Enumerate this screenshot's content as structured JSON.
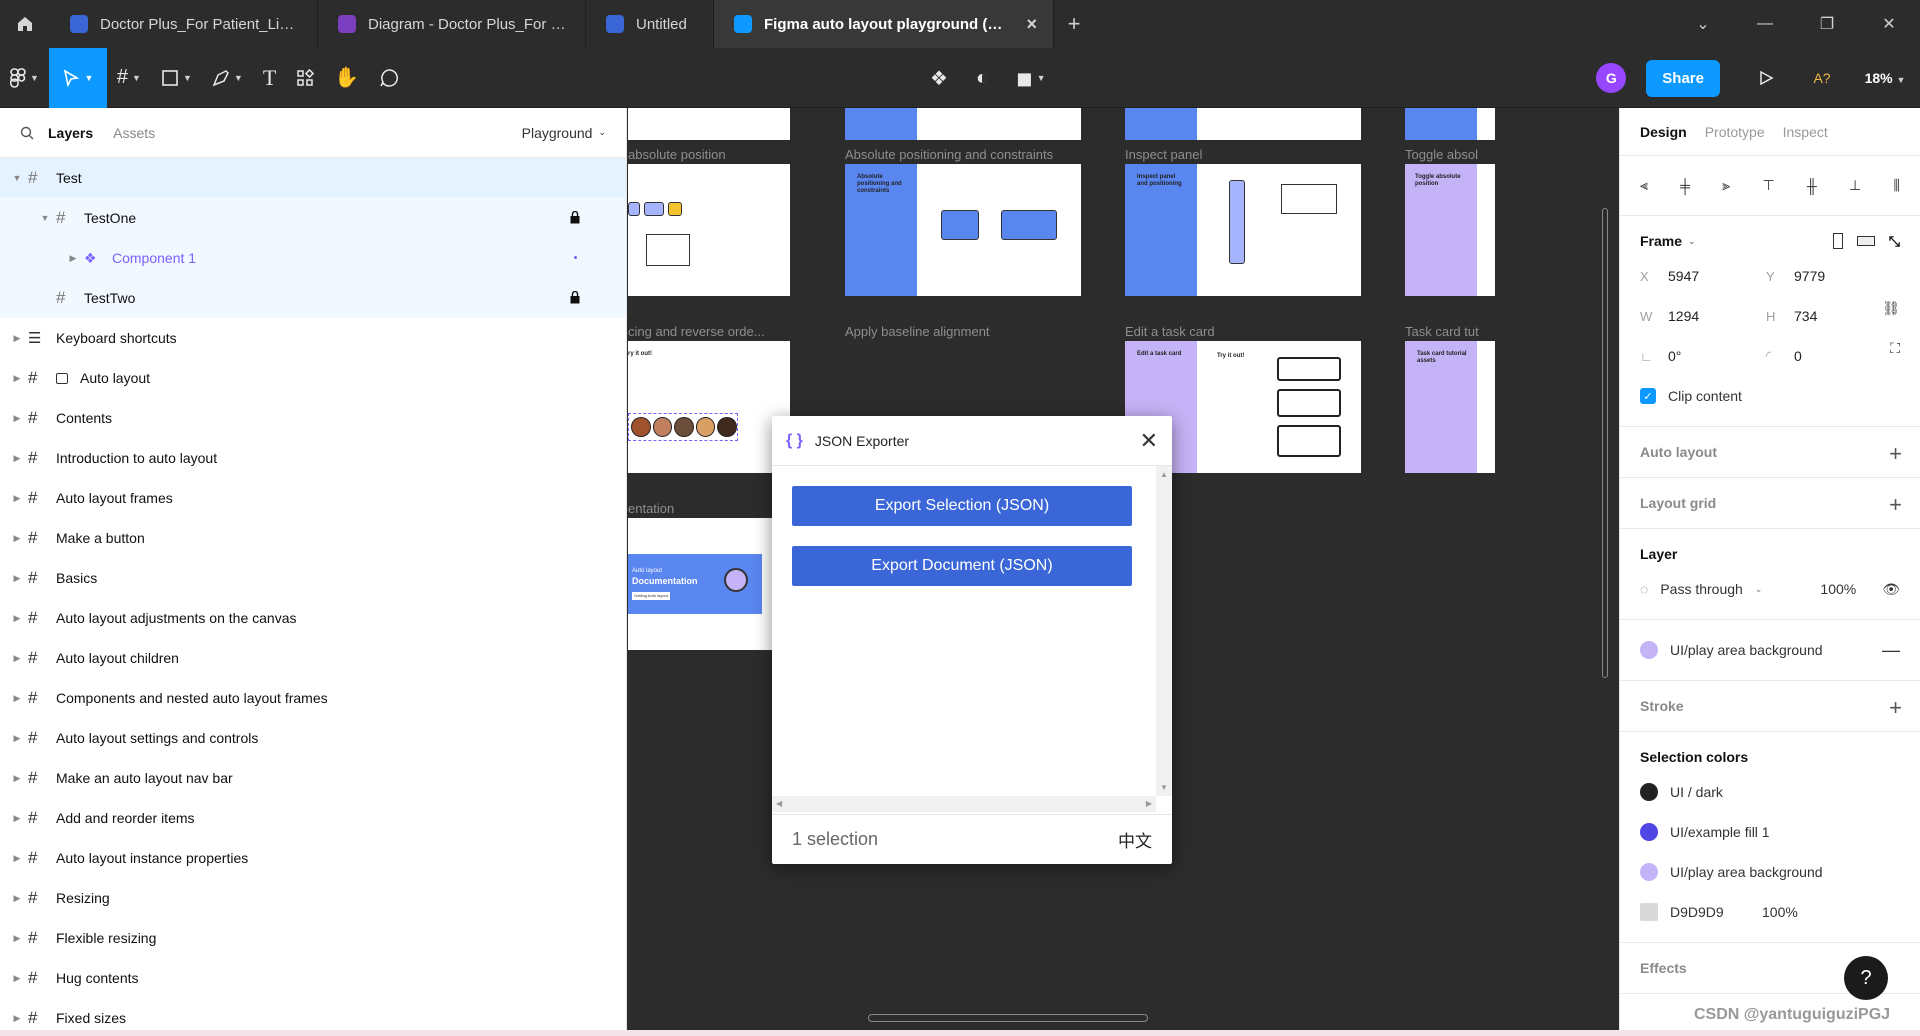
{
  "tabs": [
    {
      "label": "Doctor Plus_For Patient_Light Mode",
      "color": "#3b66d8",
      "active": false
    },
    {
      "label": "Diagram - Doctor Plus_For Patient_Light M",
      "color": "#7b3fbf",
      "active": false
    },
    {
      "label": "Untitled",
      "color": "#3b66d8",
      "active": false
    },
    {
      "label": "Figma auto layout playground (Commur",
      "color": "#0d99ff",
      "active": true
    }
  ],
  "toolbar": {
    "avatar_initial": "G",
    "share_label": "Share",
    "ai_label": "A?",
    "zoom": "18%"
  },
  "left_panel": {
    "tab_layers": "Layers",
    "tab_assets": "Assets",
    "page_name": "Playground",
    "layers": [
      {
        "name": "Test",
        "icon": "frame-icon",
        "indent": 0,
        "expanded": true,
        "state": "sel"
      },
      {
        "name": "TestOne",
        "icon": "frame-icon",
        "indent": 1,
        "expanded": true,
        "state": "child",
        "locked": true
      },
      {
        "name": "Component 1",
        "icon": "component-icon",
        "indent": 2,
        "expanded": false,
        "state": "child",
        "purple": true,
        "dot": true
      },
      {
        "name": "TestTwo",
        "icon": "frame-icon",
        "indent": 1,
        "expanded": false,
        "state": "child",
        "locked": true,
        "nocaret": true
      },
      {
        "name": "Keyboard shortcuts",
        "icon": "section-icon",
        "indent": 0
      },
      {
        "name": "Auto layout",
        "icon": "frame-icon",
        "indent": 0,
        "extra_icon": true
      },
      {
        "name": "Contents",
        "icon": "frame-icon",
        "indent": 0
      },
      {
        "name": "Introduction to auto layout",
        "icon": "frame-icon",
        "indent": 0
      },
      {
        "name": "Auto layout frames",
        "icon": "frame-icon",
        "indent": 0
      },
      {
        "name": "Make a button",
        "icon": "frame-icon",
        "indent": 0
      },
      {
        "name": "Basics",
        "icon": "frame-icon",
        "indent": 0
      },
      {
        "name": "Auto layout adjustments on the canvas",
        "icon": "frame-icon",
        "indent": 0
      },
      {
        "name": "Auto layout children",
        "icon": "frame-icon",
        "indent": 0
      },
      {
        "name": "Components and nested auto layout frames",
        "icon": "frame-icon",
        "indent": 0
      },
      {
        "name": "Auto layout settings and controls",
        "icon": "frame-icon",
        "indent": 0
      },
      {
        "name": "Make an auto layout nav bar",
        "icon": "frame-icon",
        "indent": 0
      },
      {
        "name": "Add and reorder items",
        "icon": "frame-icon",
        "indent": 0
      },
      {
        "name": "Auto layout instance properties",
        "icon": "frame-icon",
        "indent": 0
      },
      {
        "name": "Resizing",
        "icon": "frame-icon",
        "indent": 0
      },
      {
        "name": "Flexible resizing",
        "icon": "frame-icon",
        "indent": 0
      },
      {
        "name": "Hug contents",
        "icon": "frame-icon",
        "indent": 0
      },
      {
        "name": "Fixed sizes",
        "icon": "frame-icon",
        "indent": 0
      }
    ]
  },
  "canvas": {
    "labels": {
      "abs_position": "absolute position",
      "abs_constraints": "Absolute positioning and constraints",
      "inspect": "Inspect panel",
      "toggle": "Toggle absol",
      "spacing": "cing and reverse orde...",
      "baseline": "Apply baseline alignment",
      "task_card": "Edit a task card",
      "task_tut": "Task card tut",
      "documentation": "entation"
    },
    "mini": {
      "absolute": "Absolute positioning and constraints",
      "inspect": "Inspect panel and positioning",
      "toggle": "Toggle absolute position",
      "edit_task": "Edit a task card",
      "try_it": "Try it out!",
      "try_it_2": "ry it out!",
      "task_tut": "Task card tutorial assets",
      "doc_small": "Auto layout",
      "doc_big": "Documentation",
      "doc_btn": "Getting Auto layout"
    }
  },
  "dialog": {
    "title": "JSON Exporter",
    "btn_selection": "Export Selection (JSON)",
    "btn_document": "Export Document (JSON)",
    "status": "1 selection",
    "lang": "中文"
  },
  "right_panel": {
    "tabs": [
      "Design",
      "Prototype",
      "Inspect"
    ],
    "frame_label": "Frame",
    "x_label": "X",
    "x": "5947",
    "y_label": "Y",
    "y": "9779",
    "w_label": "W",
    "w": "1294",
    "h_label": "H",
    "h": "734",
    "rotation": "0°",
    "radius": "0",
    "clip_content": "Clip content",
    "auto_layout": "Auto layout",
    "layout_grid": "Layout grid",
    "layer_title": "Layer",
    "blend": "Pass through",
    "opacity": "100%",
    "fill_name": "UI/play area background",
    "fill_color": "#c5b3f7",
    "stroke": "Stroke",
    "selection_colors": "Selection colors",
    "colors": [
      {
        "name": "UI / dark",
        "color": "#222222"
      },
      {
        "name": "UI/example fill 1",
        "color": "#4f46e5"
      },
      {
        "name": "UI/play area background",
        "color": "#c5b3f7"
      },
      {
        "name": "D9D9D9",
        "color": "#d9d9d9",
        "pct": "100%",
        "square": true
      }
    ],
    "effects": "Effects",
    "help": "?"
  },
  "watermark": "CSDN @yantuguiguziPGJ"
}
